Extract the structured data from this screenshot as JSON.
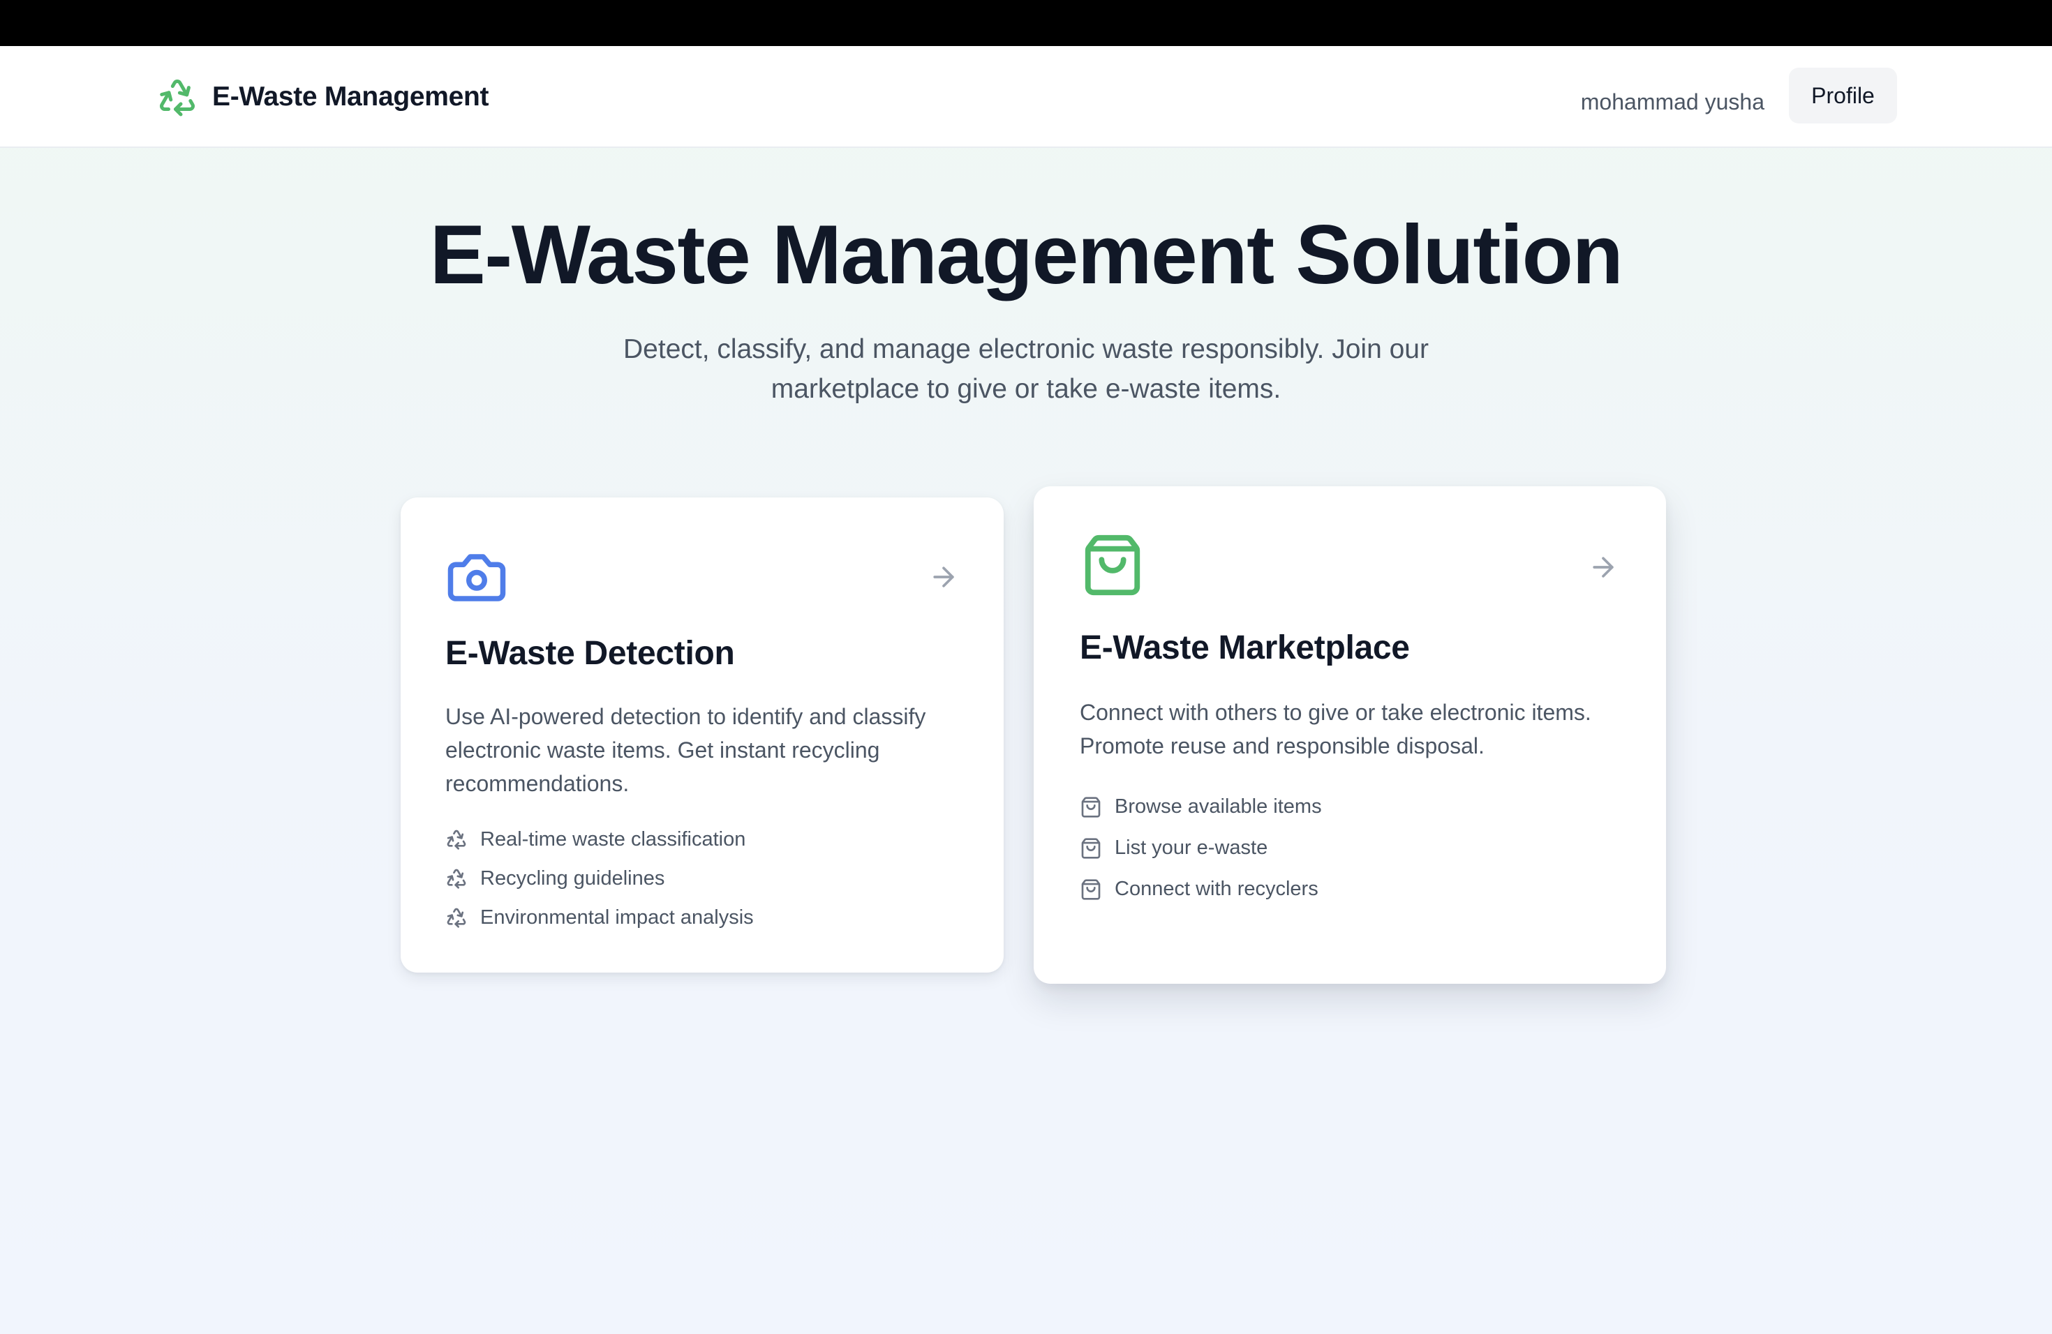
{
  "header": {
    "brand_name": "E-Waste Management",
    "brand_icon": "recycle-icon",
    "user_name": "mohammad yusha",
    "profile_label": "Profile"
  },
  "hero": {
    "title": "E-Waste Management Solution",
    "subtitle": "Detect, classify, and manage electronic waste responsibly. Join our marketplace to give or take e-waste items."
  },
  "cards": [
    {
      "icon": "camera-icon",
      "title": "E-Waste Detection",
      "description": "Use AI-powered detection to identify and classify electronic waste items. Get instant recycling recommendations.",
      "features": [
        "Real-time waste classification",
        "Recycling guidelines",
        "Environmental impact analysis"
      ],
      "feature_icon": "recycle-icon",
      "accent": "#4f7de9"
    },
    {
      "icon": "shopping-bag-icon",
      "title": "E-Waste Marketplace",
      "description": "Connect with others to give or take electronic items. Promote reuse and responsible disposal.",
      "features": [
        "Browse available items",
        "List your e-waste",
        "Connect with recyclers"
      ],
      "feature_icon": "shopping-bag-icon",
      "accent": "#52b96a"
    }
  ],
  "colors": {
    "brand_green": "#52b96a",
    "detect_blue": "#4f7de9",
    "title_text": "#111827",
    "body_text": "#4b5563",
    "arrow_gray": "#9ca3af"
  }
}
